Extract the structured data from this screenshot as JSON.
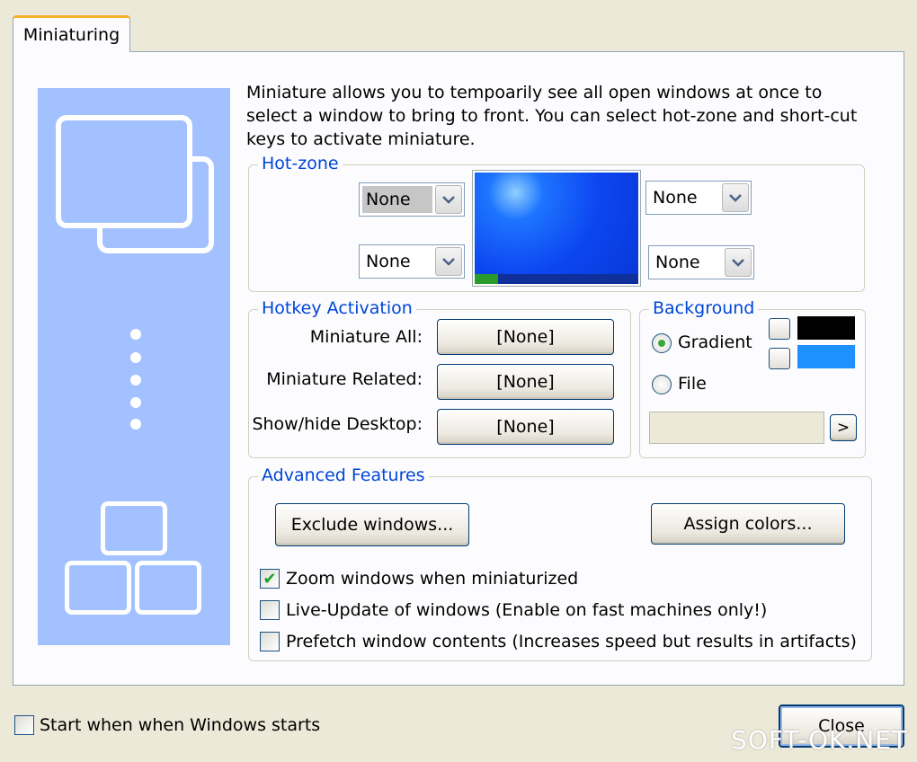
{
  "tab": {
    "label": "Miniaturing"
  },
  "description": "Miniature allows you to tempoarily see all open windows at once to select a window to bring to front. You can select hot-zone and short-cut keys to activate miniature.",
  "hotzone": {
    "legend": "Hot-zone",
    "top_left": "None",
    "bottom_left": "None",
    "top_right": "None",
    "bottom_right": "None"
  },
  "hotkeys": {
    "legend": "Hotkey Activation",
    "rows": [
      {
        "label": "Miniature All:",
        "value": "[None]"
      },
      {
        "label": "Miniature Related:",
        "value": "[None]"
      },
      {
        "label": "Show/hide Desktop:",
        "value": "[None]"
      }
    ]
  },
  "background": {
    "legend": "Background",
    "gradient_label": "Gradient",
    "file_label": "File",
    "browse_label": ">",
    "selected": "Gradient",
    "color1": "#000000",
    "color2": "#1e90ff"
  },
  "advanced": {
    "legend": "Advanced Features",
    "exclude_label": "Exclude windows...",
    "assign_label": "Assign colors...",
    "options": [
      {
        "label": "Zoom windows when miniaturized",
        "checked": true
      },
      {
        "label": "Live-Update of windows (Enable on fast machines only!)",
        "checked": false
      },
      {
        "label": "Prefetch window contents (Increases speed but results in artifacts)",
        "checked": false
      }
    ]
  },
  "footer": {
    "startup_label": "Start when when Windows starts",
    "startup_checked": false,
    "close_label": "Close"
  },
  "watermark": "SOFT-OK.NET",
  "colors": {
    "accent": "#0046d5",
    "side_art": "#a3c1ff"
  }
}
